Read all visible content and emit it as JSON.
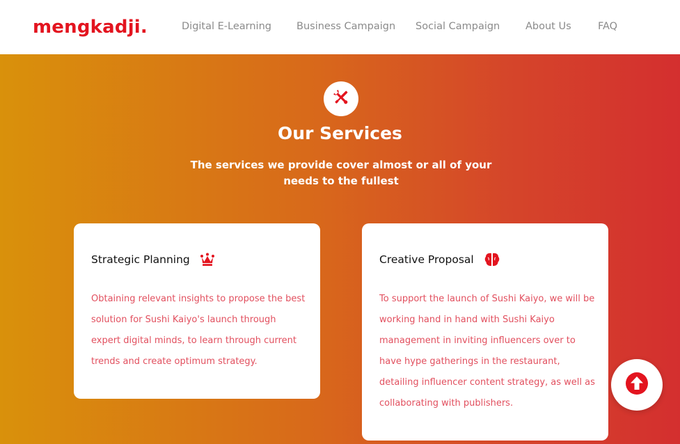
{
  "brand": {
    "logo_text": "mengkadji.",
    "accent_color": "#e3141f"
  },
  "nav": {
    "items": [
      {
        "label": "Digital E-Learning"
      },
      {
        "label": "Business Campaign"
      },
      {
        "label": "Social Campaign"
      },
      {
        "label": "About Us"
      },
      {
        "label": "FAQ"
      }
    ]
  },
  "hero": {
    "icon": "tools-icon",
    "title": "Our Services",
    "subtitle": "The services we provide cover almost or all of your needs to the fullest",
    "gradient_colors": [
      "#d9910b",
      "#d42f2f"
    ]
  },
  "cards": [
    {
      "title": "Strategic Planning",
      "icon": "crown-icon",
      "body": "Obtaining relevant insights to propose the best solution for Sushi Kaiyo's launch through expert digital minds, to learn through current trends and create optimum strategy."
    },
    {
      "title": "Creative Proposal",
      "icon": "brain-icon",
      "body": "To support the launch of Sushi Kaiyo, we will be working hand in hand with Sushi Kaiyo management in inviting influencers over to have hype gatherings in the restaurant, detailing influencer content strategy, as well as collaborating with publishers."
    }
  ],
  "scroll_top": {
    "icon": "arrow-up-circle-icon"
  },
  "colors": {
    "card_text": "#e2505f",
    "nav_text": "#8b8b8b"
  }
}
